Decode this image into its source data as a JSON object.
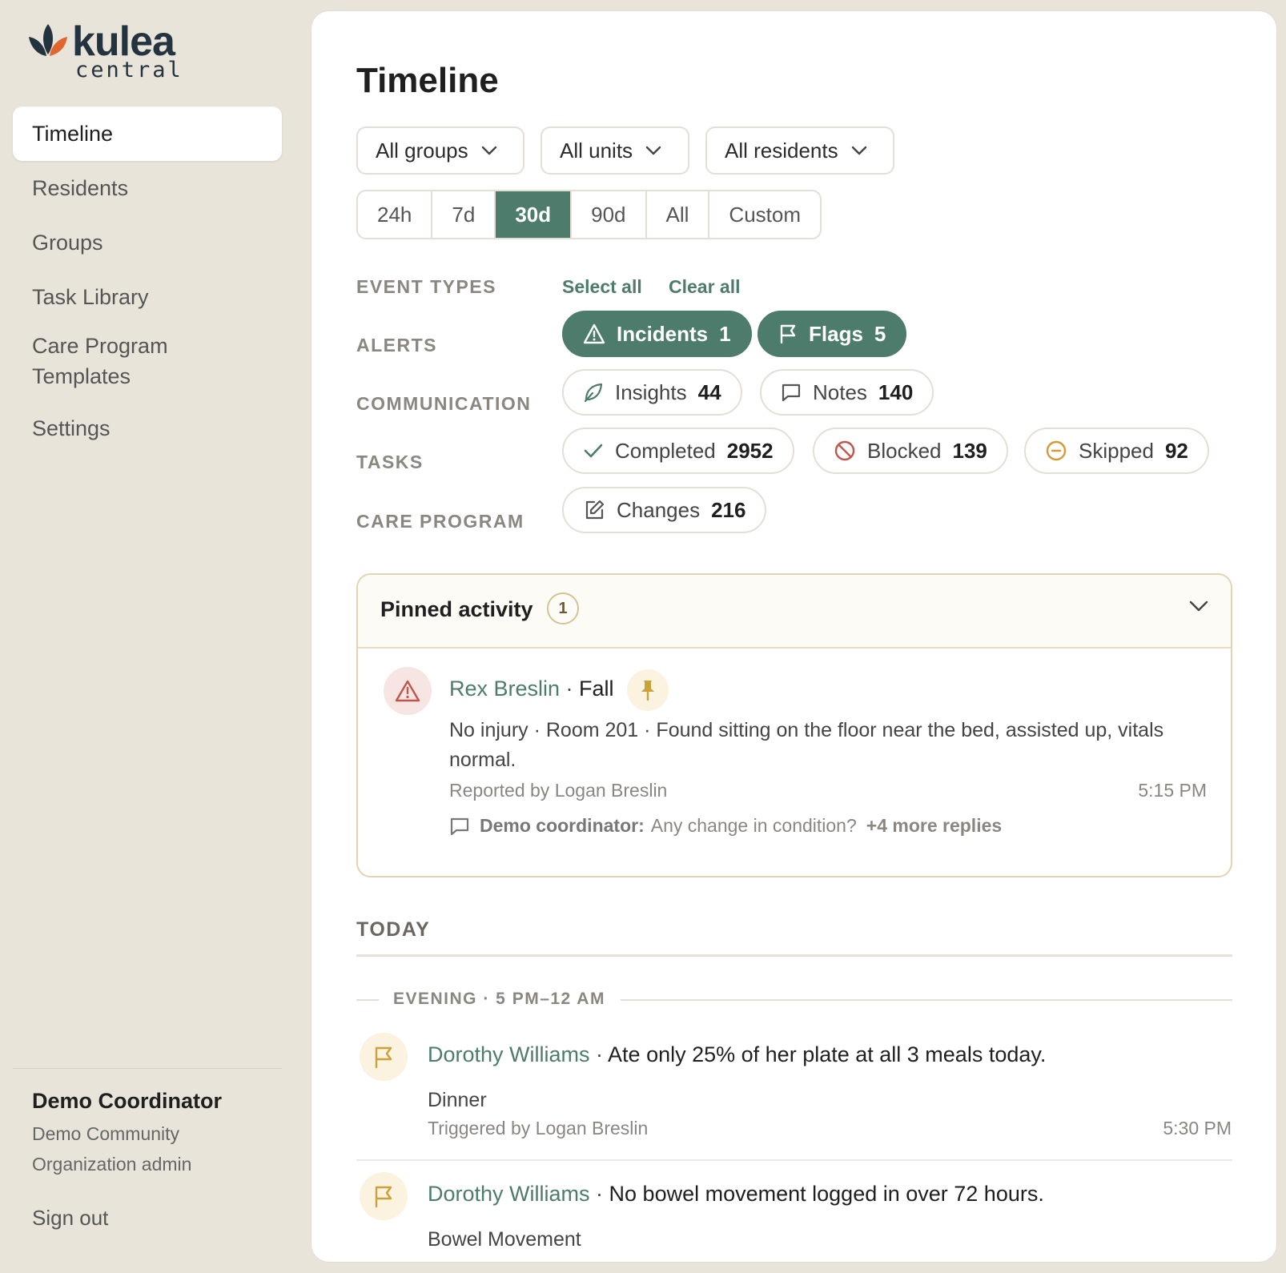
{
  "logo": {
    "word": "kulea",
    "sub": "central"
  },
  "nav": {
    "items": [
      {
        "label": "Timeline"
      },
      {
        "label": "Residents"
      },
      {
        "label": "Groups"
      },
      {
        "label": "Task Library"
      },
      {
        "label": "Care Program Templates"
      },
      {
        "label": "Settings"
      }
    ]
  },
  "user": {
    "name": "Demo Coordinator",
    "community": "Demo Community",
    "role": "Organization admin",
    "sign_out": "Sign out"
  },
  "page": {
    "title": "Timeline"
  },
  "filters": {
    "groups": "All groups",
    "units": "All units",
    "residents": "All residents",
    "ranges": [
      "24h",
      "7d",
      "30d",
      "90d",
      "All",
      "Custom"
    ],
    "active_range": "30d"
  },
  "event_types": {
    "label": "EVENT TYPES",
    "select_all": "Select all",
    "clear_all": "Clear all",
    "alerts_label": "ALERTS",
    "communication_label": "COMMUNICATION",
    "tasks_label": "TASKS",
    "care_program_label": "CARE PROGRAM",
    "chips": {
      "incidents": {
        "label": "Incidents",
        "count": "1",
        "active": true
      },
      "flags": {
        "label": "Flags",
        "count": "5",
        "active": true
      },
      "insights": {
        "label": "Insights",
        "count": "44",
        "active": false
      },
      "notes": {
        "label": "Notes",
        "count": "140",
        "active": false
      },
      "completed": {
        "label": "Completed",
        "count": "2952",
        "active": false
      },
      "blocked": {
        "label": "Blocked",
        "count": "139",
        "active": false
      },
      "skipped": {
        "label": "Skipped",
        "count": "92",
        "active": false
      },
      "changes": {
        "label": "Changes",
        "count": "216",
        "active": false
      }
    }
  },
  "pinned": {
    "title": "Pinned activity",
    "count": "1",
    "item": {
      "resident": "Rex Breslin",
      "separator": " · ",
      "type": "Fall",
      "body": "No injury · Room 201 · Found sitting on the floor near the bed, assisted up, vitals normal.",
      "reported_by": "Reported by Logan Breslin",
      "time": "5:15 PM",
      "reply_author": "Demo coordinator:",
      "reply_text": "Any change in condition?",
      "more_replies": "+4 more replies"
    }
  },
  "timeline": {
    "day": "TODAY",
    "period": "EVENING · 5 PM–12 AM",
    "rows": [
      {
        "resident": "Dorothy Williams",
        "separator": " · ",
        "text": "Ate only 25% of her plate at all 3 meals today.",
        "category": "Dinner",
        "meta": "Triggered by Logan Breslin",
        "time": "5:30 PM"
      },
      {
        "resident": "Dorothy Williams",
        "separator": " · ",
        "text": "No bowel movement logged in over 72 hours.",
        "category": "Bowel Movement"
      }
    ]
  },
  "colors": {
    "accent": "#4d7c6c",
    "background": "#e9e4da",
    "logo_orange": "#e0662e",
    "logo_dark": "#243340",
    "alert_red": "#c0564b",
    "flag_gold": "#c9a23a"
  },
  "icons": [
    "leaf-logo-icon",
    "chevron-down-icon",
    "warning-triangle-icon",
    "flag-icon",
    "leaf-icon",
    "speech-bubble-icon",
    "check-icon",
    "blocked-icon",
    "minus-circle-icon",
    "edit-icon",
    "pin-icon"
  ]
}
